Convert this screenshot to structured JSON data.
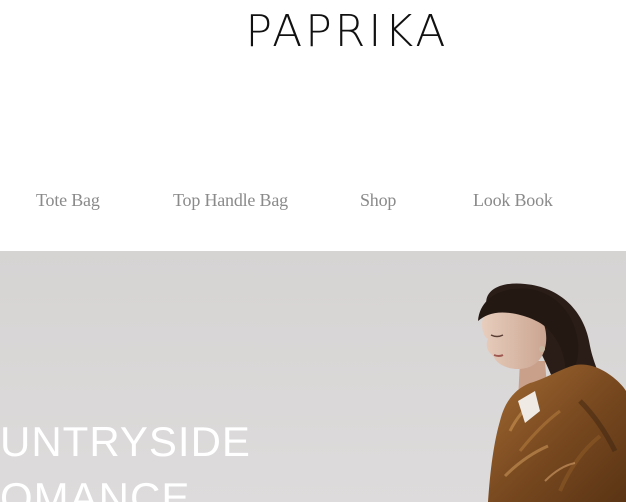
{
  "brand": {
    "name": "PAPRIKA"
  },
  "nav": {
    "items": [
      {
        "label": "Tote Bag"
      },
      {
        "label": "Top Handle Bag"
      },
      {
        "label": "Shop"
      },
      {
        "label": "Look Book"
      }
    ]
  },
  "hero": {
    "line1": "UNTRYSIDE",
    "line2": "OMANCE"
  },
  "colors": {
    "nav_text": "#8a8a8a",
    "sky": "#d8d6d6",
    "hero_text": "#ffffff"
  }
}
